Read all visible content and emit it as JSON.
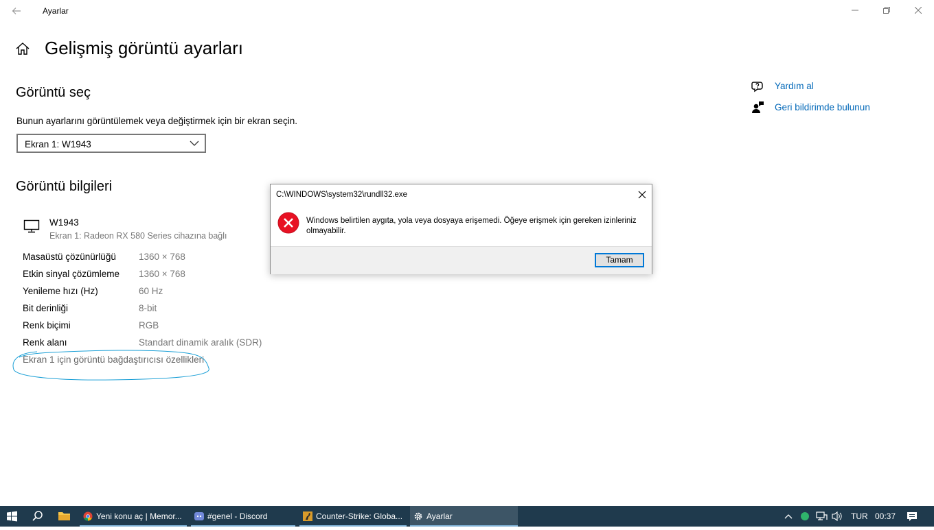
{
  "window": {
    "title": "Ayarlar"
  },
  "page": {
    "title": "Gelişmiş görüntü ayarları"
  },
  "select_section": {
    "heading": "Görüntü seç",
    "description": "Bunun ayarlarını görüntülemek veya değiştirmek için bir ekran seçin.",
    "selected": "Ekran 1: W1943"
  },
  "info_section": {
    "heading": "Görüntü bilgileri",
    "monitor_name": "W1943",
    "monitor_sub": "Ekran 1: Radeon RX 580 Series cihazına bağlı",
    "rows": [
      {
        "label": "Masaüstü çözünürlüğü",
        "value": "1360 × 768"
      },
      {
        "label": "Etkin sinyal çözümleme",
        "value": "1360 × 768"
      },
      {
        "label": "Yenileme hızı (Hz)",
        "value": "60 Hz"
      },
      {
        "label": "Bit derinliği",
        "value": "8-bit"
      },
      {
        "label": "Renk biçimi",
        "value": "RGB"
      },
      {
        "label": "Renk alanı",
        "value": "Standart dinamik aralık (SDR)"
      }
    ],
    "adapter_link": "Ekran 1 için görüntü bağdaştırıcısı özellikleri"
  },
  "side_links": {
    "help": "Yardım al",
    "feedback": "Geri bildirimde bulunun"
  },
  "dialog": {
    "title": "C:\\WINDOWS\\system32\\rundll32.exe",
    "message": "Windows belirtilen aygıta, yola veya dosyaya erişemedi.  Öğeye erişmek için gereken izinleriniz olmayabilir.",
    "ok_label": "Tamam"
  },
  "taskbar": {
    "apps": [
      {
        "label": "Yeni konu aç | Memor..."
      },
      {
        "label": "#genel - Discord"
      },
      {
        "label": "Counter-Strike: Globa..."
      },
      {
        "label": "Ayarlar"
      }
    ],
    "language": "TUR",
    "time": "00:37"
  },
  "colors": {
    "accent": "#0067b8",
    "taskbar": "#1f3a4d",
    "error": "#e81123"
  }
}
